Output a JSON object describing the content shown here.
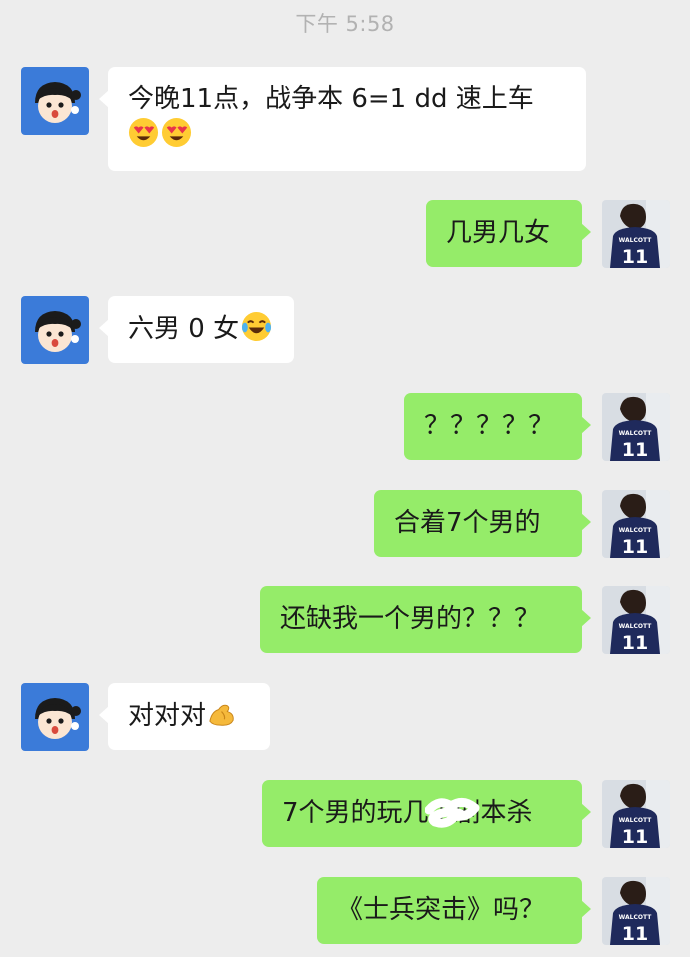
{
  "chat": {
    "timestamp": "下午 5:58",
    "messages": [
      {
        "side": "in",
        "text": "今晚11点，战争本 6=1  dd 速上车",
        "emoji_line": [
          "heart-eyes-emoji",
          "heart-eyes-emoji"
        ]
      },
      {
        "side": "out",
        "text": "几男几女"
      },
      {
        "side": "in",
        "text": "六男 0 女",
        "emoji_after": "tears-of-joy-emoji"
      },
      {
        "side": "out",
        "text": "？？？？？"
      },
      {
        "side": "out",
        "text": "合着7个男的"
      },
      {
        "side": "out",
        "text": "还缺我一个男的？？？"
      },
      {
        "side": "in",
        "text": "对对对",
        "emoji_after": "flexed-biceps-emoji"
      },
      {
        "side": "out",
        "text": "7个男的玩几个剧本杀",
        "note": "partially obscured by white scribble"
      },
      {
        "side": "out",
        "text": "《士兵突击》吗？"
      }
    ]
  },
  "avatars": {
    "friend": {
      "icon": "cartoon-boy-avatar-icon",
      "bg": "#3b7bd9"
    },
    "self": {
      "icon": "jersey-11-avatar-icon",
      "jersey_text": "WALCOTT",
      "jersey_number": "11",
      "shirt_color": "#1f2a5c"
    }
  },
  "colors": {
    "background": "#ededed",
    "incoming_bubble": "#ffffff",
    "outgoing_bubble": "#95ec69",
    "timestamp": "#b2b2b2"
  }
}
